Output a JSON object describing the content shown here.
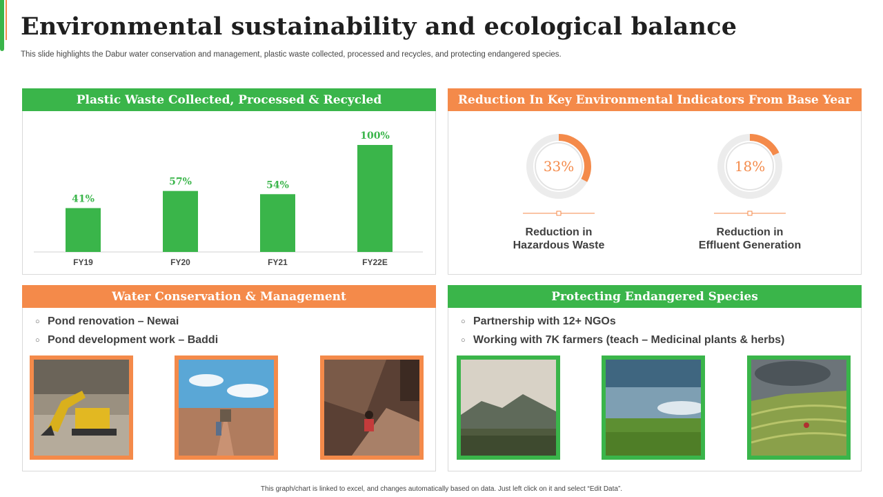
{
  "title": "Environmental sustainability and ecological balance",
  "subtitle": "This slide highlights the Dabur water conservation and management, plastic waste collected, processed and recycles, and protecting endangered species.",
  "colors": {
    "green": "#3ab54a",
    "orange": "#f48a4a"
  },
  "plastic_panel": {
    "heading": "Plastic Waste Collected, Processed & Recycled"
  },
  "reduction_panel": {
    "heading": "Reduction In Key Environmental Indicators From Base Year",
    "indicators": [
      {
        "value": "33%",
        "fraction": 0.33,
        "label_line1": "Reduction in",
        "label_line2": "Hazardous Waste"
      },
      {
        "value": "18%",
        "fraction": 0.18,
        "label_line1": "Reduction in",
        "label_line2": "Effluent Generation"
      }
    ]
  },
  "water_panel": {
    "heading": "Water Conservation & Management",
    "bullets": [
      "Pond renovation – Newai",
      "Pond development work – Baddi"
    ],
    "photos": [
      "excavator-photo",
      "construction-site-photo",
      "digging-worker-photo"
    ]
  },
  "species_panel": {
    "heading": "Protecting Endangered Species",
    "bullets": [
      "Partnership with 12+ NGOs",
      "Working with 7K farmers (teach – Medicinal plants & herbs)"
    ],
    "photos": [
      "mountain-field-photo",
      "green-field-photo",
      "terrace-farm-photo"
    ]
  },
  "chart_data": {
    "type": "bar",
    "title": "Plastic Waste Collected, Processed & Recycled",
    "categories": [
      "FY19",
      "FY20",
      "FY21",
      "FY22E"
    ],
    "values": [
      41,
      57,
      54,
      100
    ],
    "value_labels": [
      "41%",
      "57%",
      "54%",
      "100%"
    ],
    "ylim": [
      0,
      100
    ],
    "grid": false,
    "color": "#3ab54a"
  },
  "footer": "This graph/chart is linked to excel, and changes automatically based on data. Just left click on it and select “Edit Data”."
}
